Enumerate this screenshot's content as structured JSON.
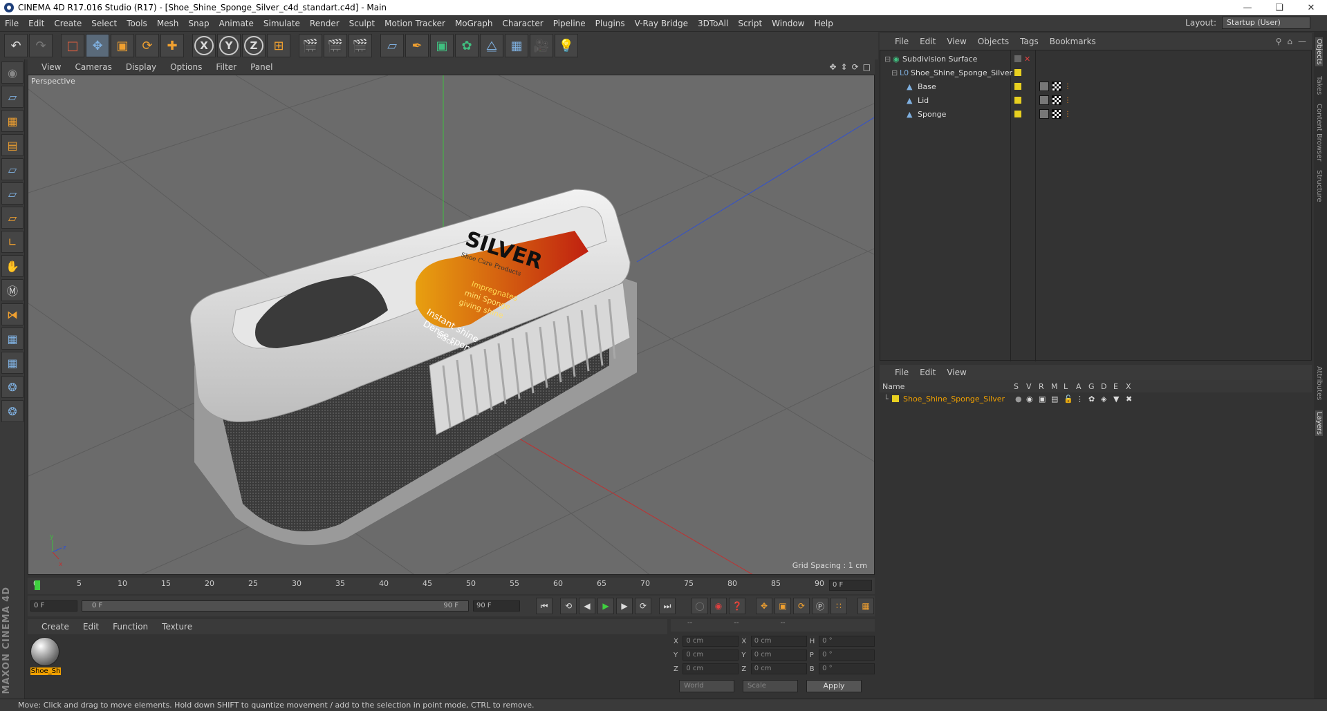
{
  "window": {
    "title": "CINEMA 4D R17.016 Studio (R17) - [Shoe_Shine_Sponge_Silver_c4d_standart.c4d] - Main"
  },
  "menubar": {
    "items": [
      "File",
      "Edit",
      "Create",
      "Select",
      "Tools",
      "Mesh",
      "Snap",
      "Animate",
      "Simulate",
      "Render",
      "Sculpt",
      "Motion Tracker",
      "MoGraph",
      "Character",
      "Pipeline",
      "Plugins",
      "V-Ray Bridge",
      "3DToAll",
      "Script",
      "Window",
      "Help"
    ],
    "layout_label": "Layout:",
    "layout_value": "Startup (User)"
  },
  "toolbar": {
    "axes": [
      "X",
      "Y",
      "Z"
    ]
  },
  "viewport": {
    "menu": [
      "View",
      "Cameras",
      "Display",
      "Options",
      "Filter",
      "Panel"
    ],
    "camera_label": "Perspective",
    "grid_spacing": "Grid Spacing : 1 cm",
    "product": {
      "brand": "SILVER",
      "tagline": "Shoe Care Products",
      "label_lines": [
        "Impregnates",
        "mini Sponge",
        "giving shine",
        "Instant shine",
        "Dense sponge",
        "black"
      ]
    }
  },
  "timeline": {
    "ticks": [
      "0",
      "5",
      "10",
      "15",
      "20",
      "25",
      "30",
      "35",
      "40",
      "45",
      "50",
      "55",
      "60",
      "65",
      "70",
      "75",
      "80",
      "85",
      "90"
    ],
    "current_frame": "0 F",
    "start_field": "0 F",
    "range_start": "0 F",
    "range_end": "90 F",
    "end_field": "90 F"
  },
  "material_manager": {
    "menu": [
      "Create",
      "Edit",
      "Function",
      "Texture"
    ],
    "materials": [
      {
        "name": "Shoe_Sh"
      }
    ]
  },
  "coordinates": {
    "header": [
      "--",
      "--",
      "--"
    ],
    "rows": [
      {
        "a": "X",
        "av": "0 cm",
        "b": "X",
        "bv": "0 cm",
        "c": "H",
        "cv": "0 °"
      },
      {
        "a": "Y",
        "av": "0 cm",
        "b": "Y",
        "bv": "0 cm",
        "c": "P",
        "cv": "0 °"
      },
      {
        "a": "Z",
        "av": "0 cm",
        "b": "Z",
        "bv": "0 cm",
        "c": "B",
        "cv": "0 °"
      }
    ],
    "space": "World",
    "mode": "Scale",
    "apply": "Apply"
  },
  "status": "Move: Click and drag to move elements. Hold down SHIFT to quantize movement / add to the selection in point mode, CTRL to remove.",
  "object_manager": {
    "menu": [
      "File",
      "Edit",
      "View",
      "Objects",
      "Tags",
      "Bookmarks"
    ],
    "objects": [
      {
        "name": "Subdivision Surface"
      },
      {
        "name": "Shoe_Shine_Sponge_Silver"
      },
      {
        "name": "Base"
      },
      {
        "name": "Lid"
      },
      {
        "name": "Sponge"
      }
    ]
  },
  "layer_manager": {
    "menu": [
      "File",
      "Edit",
      "View"
    ],
    "columns": [
      "Name",
      "S",
      "V",
      "R",
      "M",
      "L",
      "A",
      "G",
      "D",
      "E",
      "X"
    ],
    "layers": [
      {
        "name": "Shoe_Shine_Sponge_Silver"
      }
    ]
  },
  "right_tabs": [
    "Objects",
    "Takes",
    "Content Browser",
    "Structure",
    "Attributes",
    "Layers"
  ],
  "colors": {
    "accent": "#f0a000",
    "layer_yellow": "#e8d020"
  }
}
